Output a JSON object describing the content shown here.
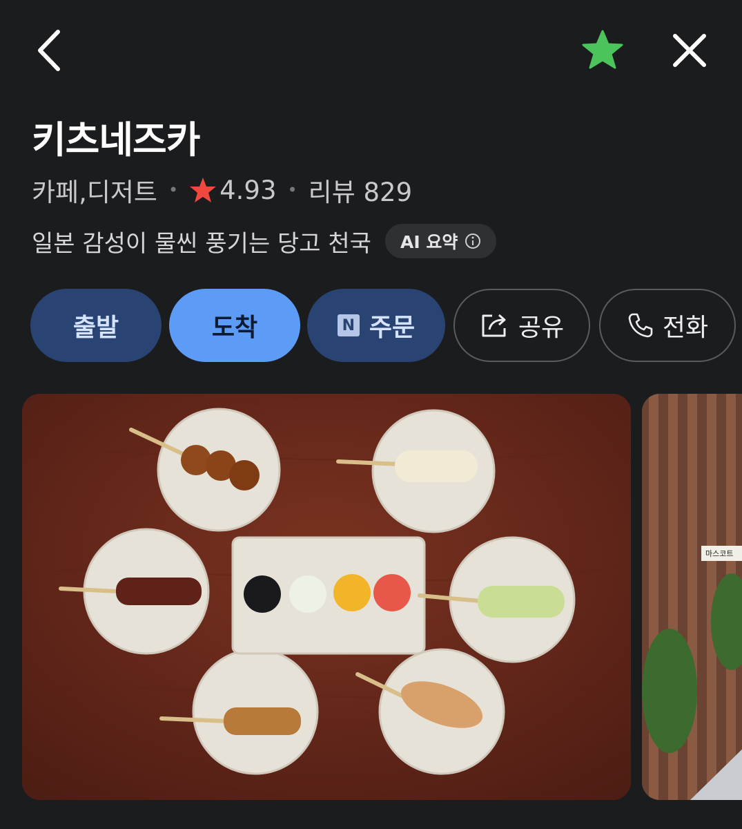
{
  "header": {
    "back_icon": "chevron-left-icon",
    "favorite_icon": "star-icon",
    "favorite_color": "#4bc55b",
    "close_icon": "close-icon"
  },
  "place": {
    "name": "키츠네즈카",
    "category": "카페,디저트",
    "rating": "4.93",
    "rating_star_color": "#f0483e",
    "reviews": "리뷰 829",
    "summary": "일본 감성이 물씬 풍기는 당고 천국",
    "ai_chip": "AI 요약"
  },
  "actions": {
    "depart": "출발",
    "arrive": "도착",
    "order_badge": "N",
    "order": "주문",
    "share": "공유",
    "call": "전화"
  },
  "photos": {
    "side_sign": "마스코트"
  }
}
